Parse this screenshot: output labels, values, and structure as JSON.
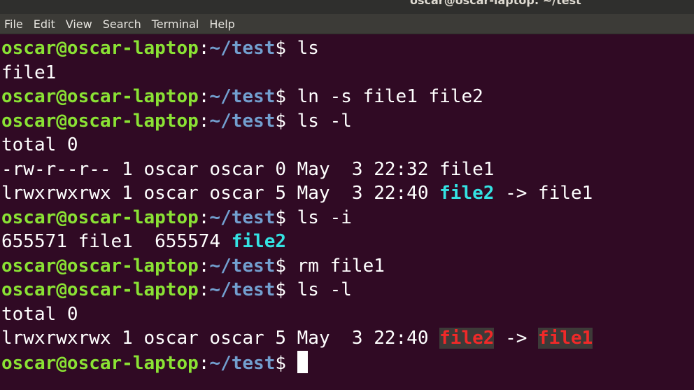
{
  "window": {
    "title": "oscar@oscar-laptop: ~/test"
  },
  "menubar": {
    "items": [
      "File",
      "Edit",
      "View",
      "Search",
      "Terminal",
      "Help"
    ]
  },
  "prompt": {
    "user_host": "oscar@oscar-laptop",
    "sep": ":",
    "path": "~/test",
    "suffix": "$ "
  },
  "terminal": {
    "lines": [
      {
        "type": "prompt",
        "cmd": "ls"
      },
      {
        "type": "text",
        "text": "file1"
      },
      {
        "type": "prompt",
        "cmd": "ln -s file1 file2"
      },
      {
        "type": "prompt",
        "cmd": "ls -l"
      },
      {
        "type": "text",
        "text": "total 0"
      },
      {
        "type": "text",
        "text": "-rw-r--r-- 1 oscar oscar 0 May  3 22:32 file1"
      },
      {
        "type": "listing",
        "prefix": "lrwxrwxrwx 1 oscar oscar 5 May  3 22:40 ",
        "link": "file2",
        "arrow": " -> ",
        "target": "file1",
        "broken": false
      },
      {
        "type": "prompt",
        "cmd": "ls -i"
      },
      {
        "type": "inode",
        "prefix": "655571 file1  655574 ",
        "link": "file2"
      },
      {
        "type": "prompt",
        "cmd": "rm file1"
      },
      {
        "type": "prompt",
        "cmd": "ls -l"
      },
      {
        "type": "text",
        "text": "total 0"
      },
      {
        "type": "listing",
        "prefix": "lrwxrwxrwx 1 oscar oscar 5 May  3 22:40 ",
        "link": "file2",
        "arrow": " -> ",
        "target": "file1",
        "broken": true
      },
      {
        "type": "prompt",
        "cmd": "",
        "cursor": true
      }
    ]
  },
  "colors": {
    "background": "#300a24",
    "prompt_user": "#8ae234",
    "prompt_path": "#729fcf",
    "symlink": "#34e2e2",
    "broken_symlink": "#ef2929",
    "broken_symlink_bg": "#3d3a38"
  }
}
